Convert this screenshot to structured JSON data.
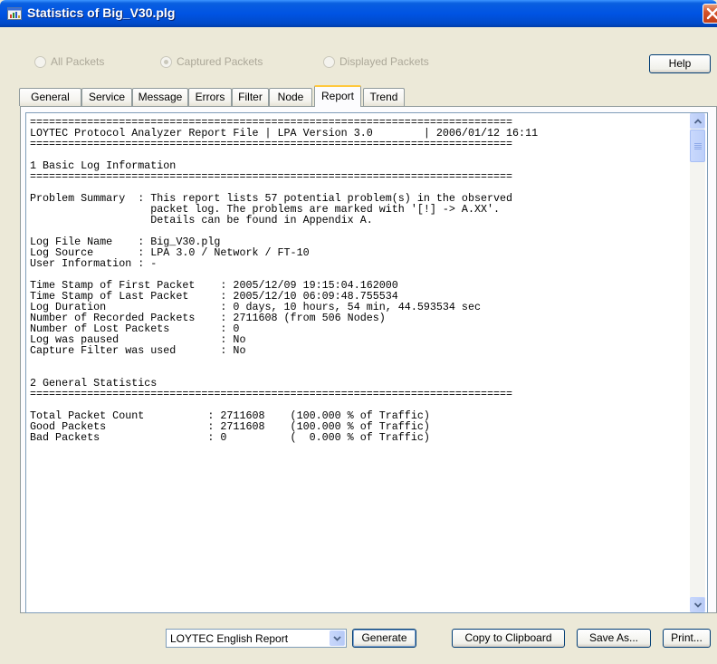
{
  "window": {
    "title": "Statistics of Big_V30.plg",
    "accent": "#0054e3",
    "close_color": "#d6542a",
    "title_icon": "chart-window-icon",
    "close_icon": "close-icon"
  },
  "filter": {
    "options": [
      {
        "label": "All Packets",
        "checked": false
      },
      {
        "label": "Captured Packets",
        "checked": true
      },
      {
        "label": "Displayed Packets",
        "checked": false
      }
    ],
    "help_label": "Help"
  },
  "tabs": [
    {
      "label": "General"
    },
    {
      "label": "Service"
    },
    {
      "label": "Message"
    },
    {
      "label": "Errors"
    },
    {
      "label": "Filter"
    },
    {
      "label": "Node"
    },
    {
      "label": "Report",
      "active": true
    },
    {
      "label": "Trend"
    }
  ],
  "report": {
    "lines": [
      "============================================================================",
      "LOYTEC Protocol Analyzer Report File | LPA Version 3.0        | 2006/01/12 16:11",
      "============================================================================",
      "",
      "1 Basic Log Information",
      "============================================================================",
      "",
      "Problem Summary  : This report lists 57 potential problem(s) in the observed",
      "                   packet log. The problems are marked with '[!] -> A.XX'.",
      "                   Details can be found in Appendix A.",
      "",
      "Log File Name    : Big_V30.plg",
      "Log Source       : LPA 3.0 / Network / FT-10",
      "User Information : -",
      "",
      "Time Stamp of First Packet    : 2005/12/09 19:15:04.162000",
      "Time Stamp of Last Packet     : 2005/12/10 06:09:48.755534",
      "Log Duration                  : 0 days, 10 hours, 54 min, 44.593534 sec",
      "Number of Recorded Packets    : 2711608 (from 506 Nodes)",
      "Number of Lost Packets        : 0",
      "Log was paused                : No",
      "Capture Filter was used       : No",
      "",
      "",
      "2 General Statistics",
      "============================================================================",
      "",
      "Total Packet Count          : 2711608    (100.000 % of Traffic)",
      "Good Packets                : 2711608    (100.000 % of Traffic)",
      "Bad Packets                 : 0          (  0.000 % of Traffic)"
    ]
  },
  "bottom": {
    "report_type": "LOYTEC English Report",
    "generate_label": "Generate",
    "copy_label": "Copy to Clipboard",
    "save_label": "Save As...",
    "print_label": "Print..."
  }
}
